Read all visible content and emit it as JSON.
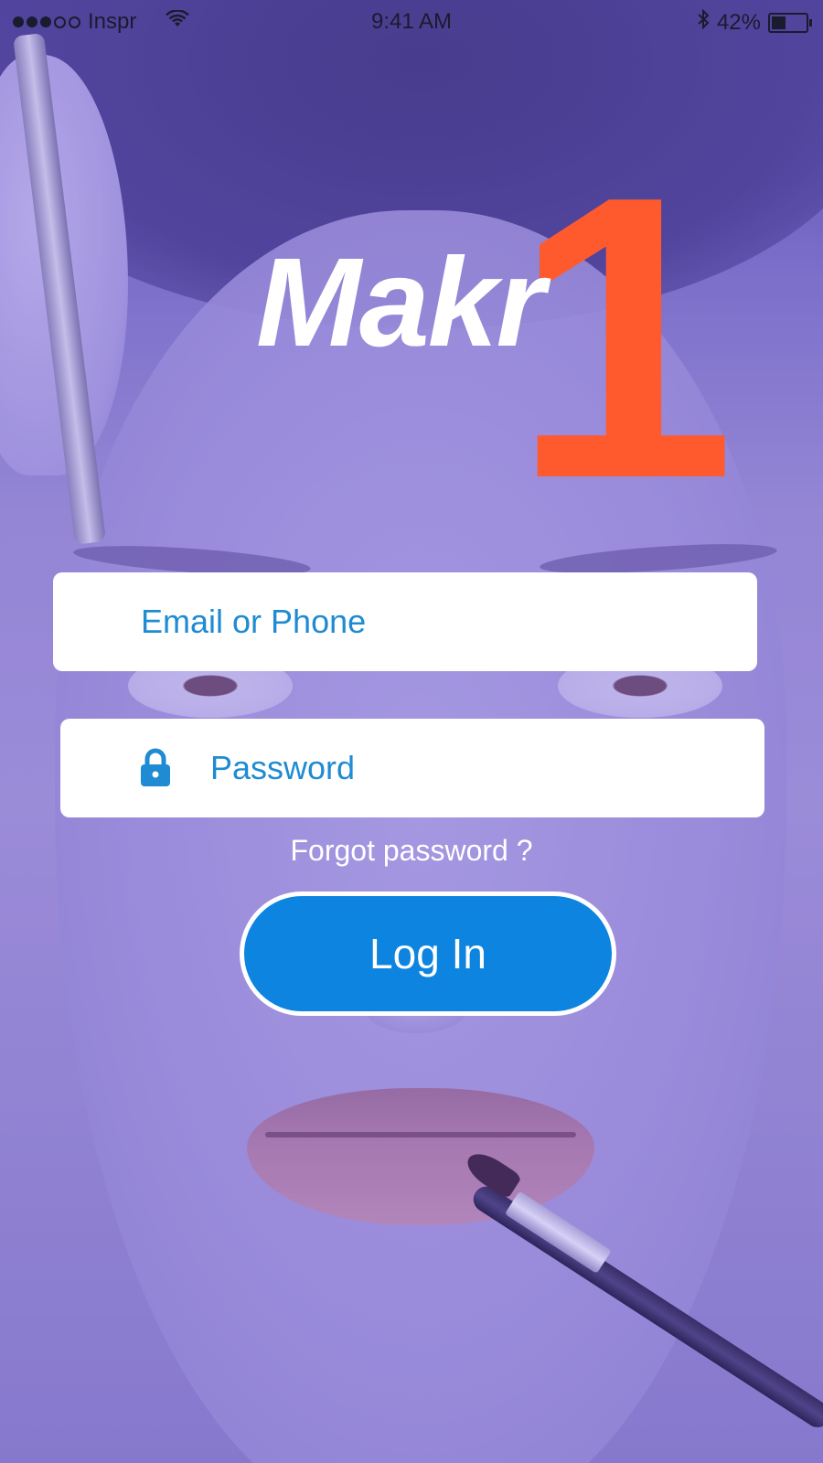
{
  "status_bar": {
    "carrier": "Inspr",
    "time": "9:41 AM",
    "battery_percent": "42%",
    "battery_level": 0.42,
    "signal_bars_full": 3,
    "signal_bars_total": 5,
    "icons": [
      "signal-dots-icon",
      "wifi-icon",
      "bluetooth-icon",
      "battery-icon"
    ]
  },
  "logo": {
    "word": "Makr",
    "number": "1",
    "number_color": "#ff5a2e"
  },
  "form": {
    "email_placeholder": "Email or Phone",
    "password_placeholder": "Password",
    "forgot_password": "Forgot password ?",
    "login_label": "Log In",
    "accent_color": "#0d84e0"
  }
}
